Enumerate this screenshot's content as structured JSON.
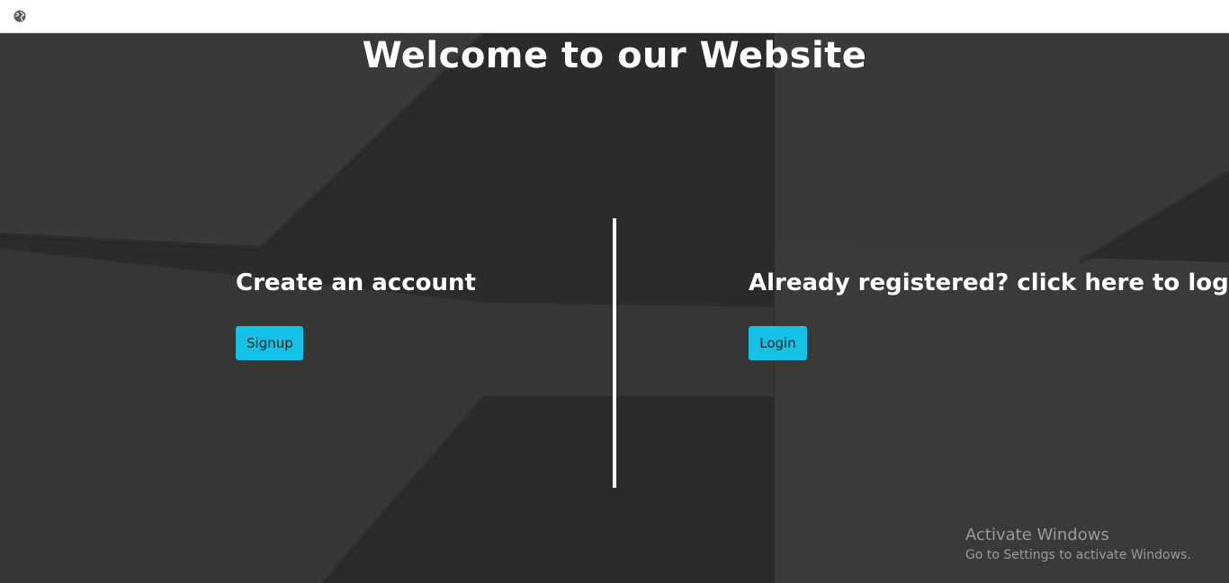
{
  "browser": {
    "icon": "globe-icon"
  },
  "page": {
    "heading": "Welcome to our Website",
    "signup": {
      "title": "Create an account",
      "button_label": "Signup"
    },
    "login": {
      "title": "Already registered? click here to login",
      "button_label": "Login"
    }
  },
  "watermark": {
    "title": "Activate Windows",
    "subtitle": "Go to Settings to activate Windows."
  },
  "colors": {
    "background": "#2b2b29",
    "button": "#14c2e8",
    "text": "#ffffff"
  }
}
